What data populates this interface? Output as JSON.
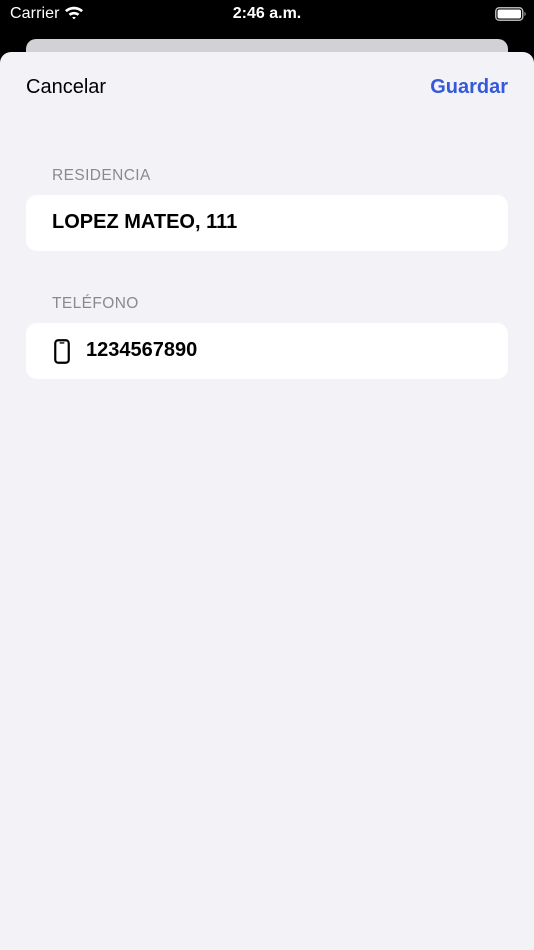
{
  "status_bar": {
    "carrier": "Carrier",
    "time": "2:46 a.m.",
    "wifi_icon": "wifi-icon",
    "battery_icon": "battery-icon"
  },
  "nav": {
    "cancel_label": "Cancelar",
    "save_label": "Guardar"
  },
  "sections": {
    "residence": {
      "header": "RESIDENCIA",
      "value": "LOPEZ MATEO, 111"
    },
    "phone": {
      "header": "TELÉFONO",
      "value": "1234567890",
      "icon": "phone-icon"
    }
  },
  "colors": {
    "accent": "#3659d9",
    "sheet_background": "#f2f2f7",
    "card_background": "#ffffff",
    "section_header": "#8a8a8e"
  }
}
